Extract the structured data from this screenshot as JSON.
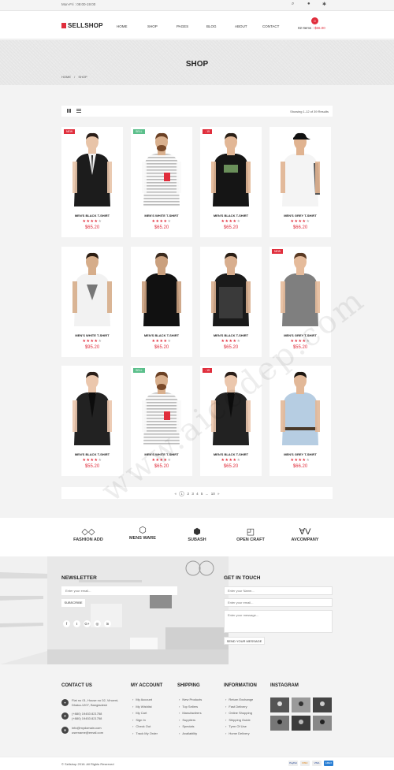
{
  "topbar": {
    "hours": "Mon-Fri : 09:00-19:00",
    "search_icon": "search-icon",
    "user_icon": "user-icon",
    "settings_icon": "gear-icon"
  },
  "header": {
    "logo": "SELLSHOP",
    "nav": [
      "HOME",
      "SHOP",
      "PAGES",
      "BLOG",
      "ABOUT",
      "CONTACT"
    ],
    "cart": {
      "count": "0",
      "items": "02 Items :",
      "total": "$66.00"
    }
  },
  "banner": {
    "title": "SHOP",
    "breadcrumb": [
      "HOME",
      "/",
      "SHOP"
    ]
  },
  "toolbar": {
    "grid_icon": "grid-view-icon",
    "list_icon": "list-view-icon",
    "results": "Showing 1-12 of 39 Results"
  },
  "colors": {
    "accent": "#e02e3c",
    "sell_badge": "#5bbf8b"
  },
  "products": [
    {
      "name": "MEN'S BLACK T-SHIRT",
      "price": "$65.20",
      "rating": 4,
      "badge": "NEW",
      "badge_color": "#e02e3c",
      "look": "suit-black"
    },
    {
      "name": "MEN'S WHITE T-SHIRT",
      "price": "$65.20",
      "rating": 4,
      "badge": "SELL",
      "badge_color": "#5bbf8b",
      "look": "stripe-white"
    },
    {
      "name": "MEN'S BLACK T-SHIRT",
      "price": "$65.20",
      "rating": 4,
      "badge": "- 15",
      "badge_color": "#e02e3c",
      "look": "tee-black"
    },
    {
      "name": "MEN'S GREY T-SHIRT",
      "price": "$66.20",
      "rating": 4,
      "badge": "",
      "badge_color": "",
      "look": "tee-white-pattern"
    },
    {
      "name": "MEN'S WHITE T-SHIRT",
      "price": "$95.20",
      "rating": 4,
      "badge": "",
      "badge_color": "",
      "look": "tee-white-print"
    },
    {
      "name": "MEN'S BLACK T-SHIRT",
      "price": "$65.20",
      "rating": 4,
      "badge": "",
      "badge_color": "",
      "look": "tee-black-back"
    },
    {
      "name": "MEN'S BLACK T-SHIRT",
      "price": "$65.20",
      "rating": 4,
      "badge": "",
      "badge_color": "",
      "look": "tee-black-leather"
    },
    {
      "name": "MEN'S GREY T-SHIRT",
      "price": "$55.20",
      "rating": 4,
      "badge": "NEW",
      "badge_color": "#e02e3c",
      "look": "tee-grey"
    },
    {
      "name": "MEN'S BLACK T-SHIRT",
      "price": "$55.20",
      "rating": 4,
      "badge": "",
      "badge_color": "",
      "look": "blazer-black"
    },
    {
      "name": "MEN'S WHITE T-SHIRT",
      "price": "$65.20",
      "rating": 4,
      "badge": "SELL",
      "badge_color": "#5bbf8b",
      "look": "stripe-white"
    },
    {
      "name": "MEN'S BLACK T-SHIRT",
      "price": "$65.20",
      "rating": 4,
      "badge": "- 15",
      "badge_color": "#e02e3c",
      "look": "blazer-black"
    },
    {
      "name": "MEN'S GREY T-SHIRT",
      "price": "$66.20",
      "rating": 4,
      "badge": "",
      "badge_color": "",
      "look": "shirt-blue"
    }
  ],
  "pagination": {
    "prev": "«",
    "pages": [
      "1",
      "2",
      "3",
      "4",
      "5",
      "...",
      "10"
    ],
    "next": "»"
  },
  "brands": [
    {
      "name": "FASHION ADD",
      "icon": "fashion-add-logo-icon"
    },
    {
      "name": "MENS WARE",
      "icon": "mens-ware-logo-icon"
    },
    {
      "name": "SUBASH",
      "icon": "subash-logo-icon"
    },
    {
      "name": "OPEN CRAFT",
      "icon": "open-craft-logo-icon"
    },
    {
      "name": "AVCOMPANY",
      "icon": "avcompany-logo-icon"
    }
  ],
  "newsletter": {
    "title": "NEWSLETTER",
    "placeholder": "Enter your email...",
    "button": "SUBSCRIBE",
    "social": [
      "f",
      "t",
      "G+",
      "◎",
      "in"
    ]
  },
  "contact_form": {
    "title": "GET IN TOUCH",
    "name_placeholder": "Enter your Name...",
    "email_placeholder": "Enter your email...",
    "message_placeholder": "Enter your message...",
    "button": "SEND YOUR MESSAGE"
  },
  "footer": {
    "contact": {
      "title": "CONTACT US",
      "address": [
        "Flat no 01, House no 02, Vincent,",
        "Dhaka-1207, Bangladesh"
      ],
      "phones": [
        "(+880) 19453 821758",
        "(+880) 19453 821758"
      ],
      "emails": [
        "info@mydomain.com",
        "username@email.com"
      ]
    },
    "my_account": {
      "title": "MY ACCOUNT",
      "links": [
        "My Account",
        "My Wishlist",
        "My Cart",
        "Sign In",
        "Check Out",
        "Track My Order"
      ]
    },
    "shipping": {
      "title": "SHIPPING",
      "links": [
        "New Products",
        "Top Sellers",
        "Manufactirers",
        "Suppliers",
        "Specials",
        "Availability"
      ]
    },
    "information": {
      "title": "INFORMATION",
      "links": [
        "Return Exchange",
        "Fast Delivery",
        "Online Shopping",
        "Shipping Guide",
        "Tyrm Of Use",
        "Home Delivery"
      ]
    },
    "instagram": {
      "title": "INSTAGRAM"
    }
  },
  "bottom": {
    "copyright": "© Sellshop 2016. All Rights Reserved",
    "payments": [
      "PayPal",
      "DISC",
      "VISA",
      "AMEX"
    ]
  },
  "watermark": "www.aicodep.com"
}
